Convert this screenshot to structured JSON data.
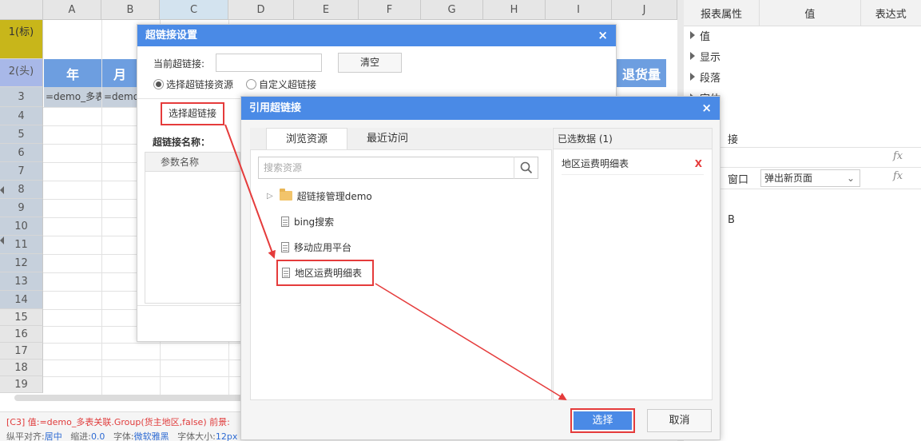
{
  "sheet": {
    "columns": [
      "A",
      "B",
      "C",
      "D",
      "E",
      "F",
      "G",
      "H",
      "I",
      "J"
    ],
    "rows": [
      "1(标)",
      "2(头)",
      "3",
      "4",
      "5",
      "6",
      "7",
      "8",
      "9",
      "10",
      "11",
      "12",
      "13",
      "14",
      "15",
      "16",
      "17",
      "18",
      "19"
    ],
    "header_cells": {
      "year": "年",
      "month": "月",
      "returns": "退货量"
    },
    "c3_a": "=demo_多表",
    "c3_b": "=demo",
    "status_line1": "[C3] 值:=demo_多表关联.Group(货主地区,false) 前景:",
    "status_line2_parts": [
      {
        "label": "纵平对齐:",
        "value": "居中"
      },
      {
        "label": "缩进:",
        "value": "0.0"
      },
      {
        "label": "字体:",
        "value": "微软雅黑"
      },
      {
        "label": "字体大小:",
        "value": "12px"
      }
    ]
  },
  "panel": {
    "headers": [
      "报表属性",
      "值",
      "表达式"
    ],
    "groups": [
      "值",
      "显示",
      "段落",
      "字体"
    ],
    "partial_label_1": "接",
    "partial_label_2": "窗口",
    "window_value": "弹出新页面",
    "partial_label_3": "B",
    "fx": "fx"
  },
  "hyperlink_dialog": {
    "title": "超链接设置",
    "current_label": "当前超链接:",
    "current_value": "",
    "clear_button": "清空",
    "radio_resource": "选择超链接资源",
    "radio_custom": "自定义超链接",
    "choose_button": "选择超链接",
    "name_label": "超链接名称：",
    "param_header": "参数名称"
  },
  "reference_dialog": {
    "title": "引用超链接",
    "tabs": [
      "浏览资源",
      "最近访问"
    ],
    "search_placeholder": "搜索资源",
    "tree": [
      {
        "type": "folder",
        "label": "超链接管理demo"
      },
      {
        "type": "doc",
        "label": "bing搜索"
      },
      {
        "type": "doc",
        "label": "移动应用平台"
      },
      {
        "type": "doc",
        "label": "地区运费明细表"
      }
    ],
    "selected_header": "已选数据 (1)",
    "selected_items": [
      "地区运费明细表"
    ],
    "remove_glyph": "X",
    "select_button": "选择",
    "cancel_button": "取消"
  },
  "colors": {
    "accent": "#4a8ae6",
    "highlight_red": "#e53b3b",
    "header_blue": "#6d9ee0",
    "title_row": "#c8b61a"
  }
}
